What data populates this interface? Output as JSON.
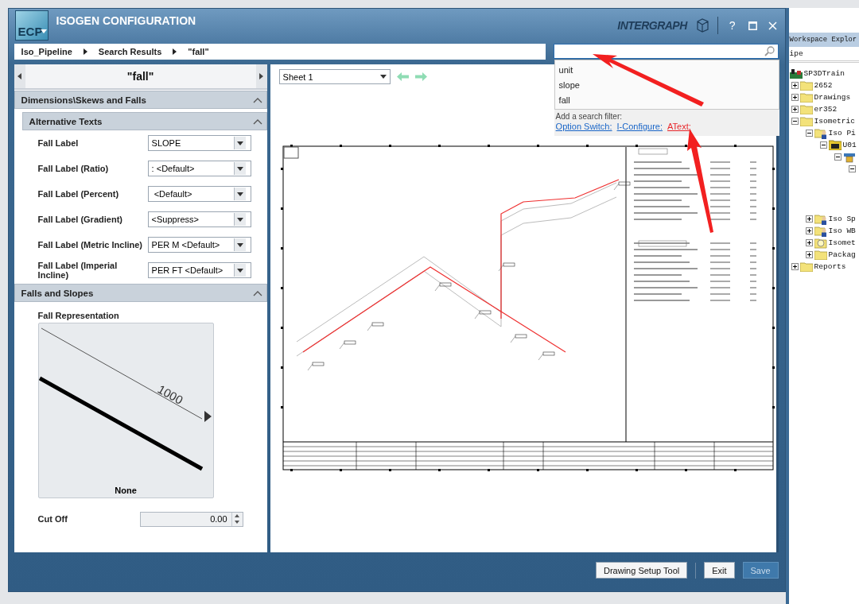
{
  "window": {
    "logo": "ECP",
    "title": "ISOGEN CONFIGURATION",
    "brand": "INTERGRAPH",
    "help": "?"
  },
  "breadcrumb": [
    "Iso_Pipeline",
    "Search Results",
    "\"fall\""
  ],
  "search": {
    "suggestions": [
      "unit",
      "slope",
      "fall"
    ],
    "filter_label": "Add a search filter:",
    "filters": [
      {
        "label": "Option Switch:",
        "color": "#1a66c8"
      },
      {
        "label": "I-Configure:",
        "color": "#1a66c8"
      },
      {
        "label": "AText:",
        "color": "#e8262a"
      }
    ]
  },
  "left_panel": {
    "title": "\"fall\"",
    "sections": [
      {
        "kind": "group",
        "title": "Dimensions\\Skews and Falls",
        "expanded": true,
        "subsections": [
          {
            "title": "Alternative Texts",
            "expanded": true,
            "fields": [
              {
                "label": "Fall Label",
                "value": "SLOPE"
              },
              {
                "label": "Fall Label (Ratio)",
                "value": ": <Default>"
              },
              {
                "label": "Fall Label (Percent)",
                "value": " <Default>"
              },
              {
                "label": "Fall Label (Gradient)",
                "value": "<Suppress>"
              },
              {
                "label": "Fall Label (Metric Incline)",
                "value": "PER M <Default>"
              },
              {
                "label": "Fall Label (Imperial Incline)",
                "value": "PER FT <Default>"
              }
            ]
          }
        ]
      },
      {
        "kind": "figure",
        "title": "Falls and Slopes",
        "expanded": true,
        "figure_label": "Fall Representation",
        "figure_text": "1000",
        "caption": "None",
        "spin_label": "Cut Off",
        "spin_value": "0.00"
      }
    ]
  },
  "preview": {
    "sheet": "Sheet 1"
  },
  "footer": {
    "buttons": [
      {
        "label": "Drawing Setup Tool",
        "disabled": false
      },
      {
        "label": "Exit",
        "disabled": false
      },
      {
        "label": "Save",
        "disabled": true
      }
    ]
  },
  "explorer": {
    "title": "Workspace Explor",
    "filter": "ipe",
    "tree": [
      {
        "label": "SP3DTrain",
        "kind": "project",
        "children": [
          {
            "label": "2652",
            "kind": "folder",
            "expanded": false
          },
          {
            "label": "Drawings",
            "kind": "folder",
            "expanded": false
          },
          {
            "label": "er352",
            "kind": "folder",
            "expanded": false
          },
          {
            "label": "Isometric",
            "kind": "folder",
            "expanded": true,
            "children": [
              {
                "label": "Iso Pi",
                "kind": "config",
                "expanded": true,
                "children": [
                  {
                    "label": "U01",
                    "kind": "drawings",
                    "expanded": true,
                    "children": [
                      {
                        "kind": "pipe",
                        "expanded": true,
                        "children": [
                          {
                            "expanded": true
                          }
                        ]
                      }
                    ]
                  }
                ]
              },
              {
                "label": "Iso Sp",
                "kind": "config",
                "expanded": false
              },
              {
                "label": "Iso WB",
                "kind": "config",
                "expanded": false
              },
              {
                "label": "Isomet",
                "kind": "bulb",
                "expanded": false
              },
              {
                "label": "Packag",
                "kind": "folder",
                "expanded": false
              }
            ]
          },
          {
            "label": "Reports",
            "kind": "folder",
            "expanded": false
          }
        ]
      }
    ]
  }
}
